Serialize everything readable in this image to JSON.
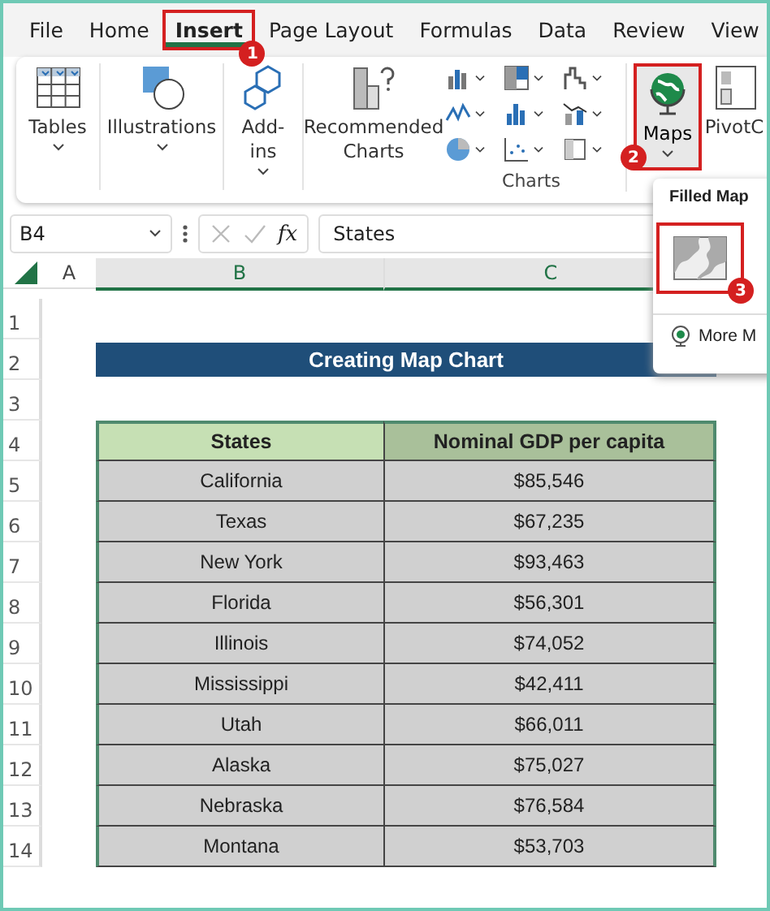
{
  "tabs": [
    {
      "label": "File",
      "selected": false
    },
    {
      "label": "Home",
      "selected": false
    },
    {
      "label": "Insert",
      "selected": true
    },
    {
      "label": "Page Layout",
      "selected": false
    },
    {
      "label": "Formulas",
      "selected": false
    },
    {
      "label": "Data",
      "selected": false
    },
    {
      "label": "Review",
      "selected": false
    },
    {
      "label": "View",
      "selected": false
    }
  ],
  "ribbon": {
    "buttons": [
      {
        "label": "Tables",
        "kind": "tables"
      },
      {
        "label": "Illustrations",
        "kind": "illustrations"
      },
      {
        "label": "Add-ins",
        "kind": "addins"
      },
      {
        "label": "Recommended Charts",
        "kind": "recommended"
      }
    ],
    "charts_group_label": "Charts",
    "maps_button": {
      "label": "Maps",
      "selected": true
    },
    "pivot_button": {
      "label": "PivotC"
    }
  },
  "maps_menu": {
    "title": "Filled Map",
    "more_item": "More M"
  },
  "annotations": [
    {
      "label": "1"
    },
    {
      "label": "2"
    },
    {
      "label": "3"
    }
  ],
  "formula_bar": {
    "name_box": "B4",
    "function_button": "fx",
    "value": "States"
  },
  "columns": [
    "A",
    "B",
    "C"
  ],
  "row_numbers": [
    "1",
    "2",
    "3",
    "4",
    "5",
    "6",
    "7",
    "8",
    "9",
    "10",
    "11",
    "12",
    "13",
    "14"
  ],
  "sheet": {
    "title": "Creating Map Chart",
    "table": {
      "columns": [
        "States",
        "Nominal GDP per capita"
      ],
      "rows": [
        [
          "California",
          "$85,546"
        ],
        [
          "Texas",
          "$67,235"
        ],
        [
          "New York",
          "$93,463"
        ],
        [
          "Florida",
          "$56,301"
        ],
        [
          "Illinois",
          "$74,052"
        ],
        [
          "Mississippi",
          "$42,411"
        ],
        [
          "Utah",
          "$66,011"
        ],
        [
          "Alaska",
          "$75,027"
        ],
        [
          "Nebraska",
          "$76,584"
        ],
        [
          "Montana",
          "$53,703"
        ]
      ]
    }
  }
}
